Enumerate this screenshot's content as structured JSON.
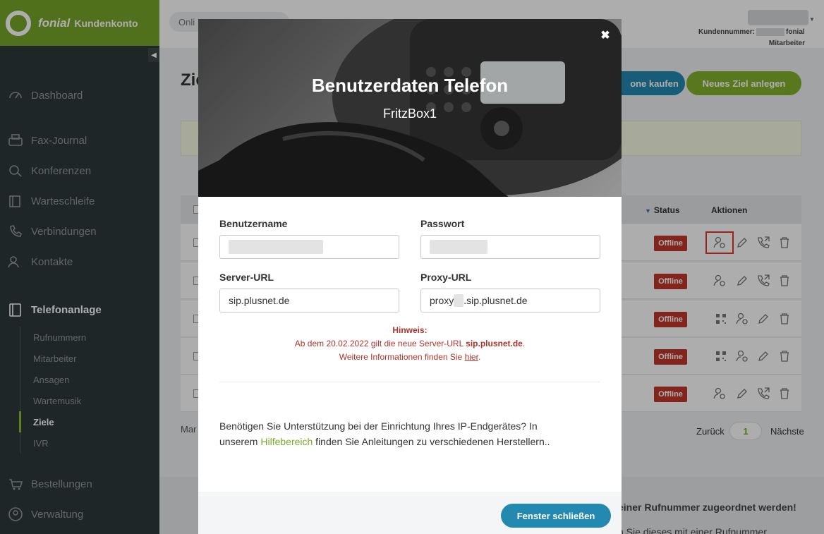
{
  "brand": {
    "name": "fonial",
    "subtitle": "Kundenkonto"
  },
  "sidebar": {
    "collapse_icon": "◀",
    "items": [
      {
        "label": "Dashboard",
        "icon": "gauge-icon"
      },
      {
        "label": "Fax-Journal",
        "icon": "fax-icon"
      },
      {
        "label": "Konferenzen",
        "icon": "conference-icon"
      },
      {
        "label": "Warteschleife",
        "icon": "queue-icon"
      },
      {
        "label": "Verbindungen",
        "icon": "phone-icon"
      },
      {
        "label": "Kontakte",
        "icon": "contacts-icon"
      },
      {
        "label": "Telefonanlage",
        "icon": "pbx-icon"
      },
      {
        "label": "Bestellungen",
        "icon": "cart-icon"
      },
      {
        "label": "Verwaltung",
        "icon": "user-circle-icon"
      }
    ],
    "sub_items": [
      "Rufnummern",
      "Mitarbeiter",
      "Ansagen",
      "Wartemusik",
      "Ziele",
      "IVR"
    ]
  },
  "topbar": {
    "online_label": "Onli",
    "kundennummer_label": "Kundennummer:",
    "kundennummer_suffix": "fonial",
    "role": "Mitarbeiter"
  },
  "page": {
    "title": "Zie",
    "buy_button": "one kaufen",
    "new_button": "Neues Ziel anlegen",
    "columns": {
      "status": "Status",
      "actions": "Aktionen"
    },
    "rows": [
      {
        "status": "Offline"
      },
      {
        "status": "Offline"
      },
      {
        "status": "Offline"
      },
      {
        "status": "Offline"
      },
      {
        "status": "Offline"
      }
    ],
    "footer_left": "Mar",
    "pager": {
      "prev": "Zurück",
      "current": "1",
      "next": "Nächste"
    },
    "bottom_text_1": "einer Rufnummer zugeordnet werden!",
    "bottom_text_2": "n Sie dieses mit einer Rufnummer"
  },
  "modal": {
    "close_icon": "✖",
    "title": "Benutzerdaten Telefon",
    "subtitle": "FritzBox1",
    "username_label": "Benutzername",
    "password_label": "Passwort",
    "server_label": "Server-URL",
    "server_value": "sip.plusnet.de",
    "proxy_label": "Proxy-URL",
    "proxy_prefix": "proxy",
    "proxy_suffix": ".sip.plusnet.de",
    "hint_title": "Hinweis:",
    "hint_line1_a": "Ab dem 20.02.2022 gilt die neue Server-URL ",
    "hint_line1_b": "sip.plusnet.de",
    "hint_line1_c": ".",
    "hint_line2_a": "Weitere Informationen finden Sie ",
    "hint_line2_link": "hier",
    "hint_line2_c": ".",
    "help_a": "Benötigen Sie Unterstützung bei der Einrichtung Ihres IP-Endgerätes? In unserem ",
    "help_link": "Hilfebereich",
    "help_b": " finden Sie Anleitungen zu verschiedenen Herstellern..",
    "close_button": "Fenster schließen"
  }
}
